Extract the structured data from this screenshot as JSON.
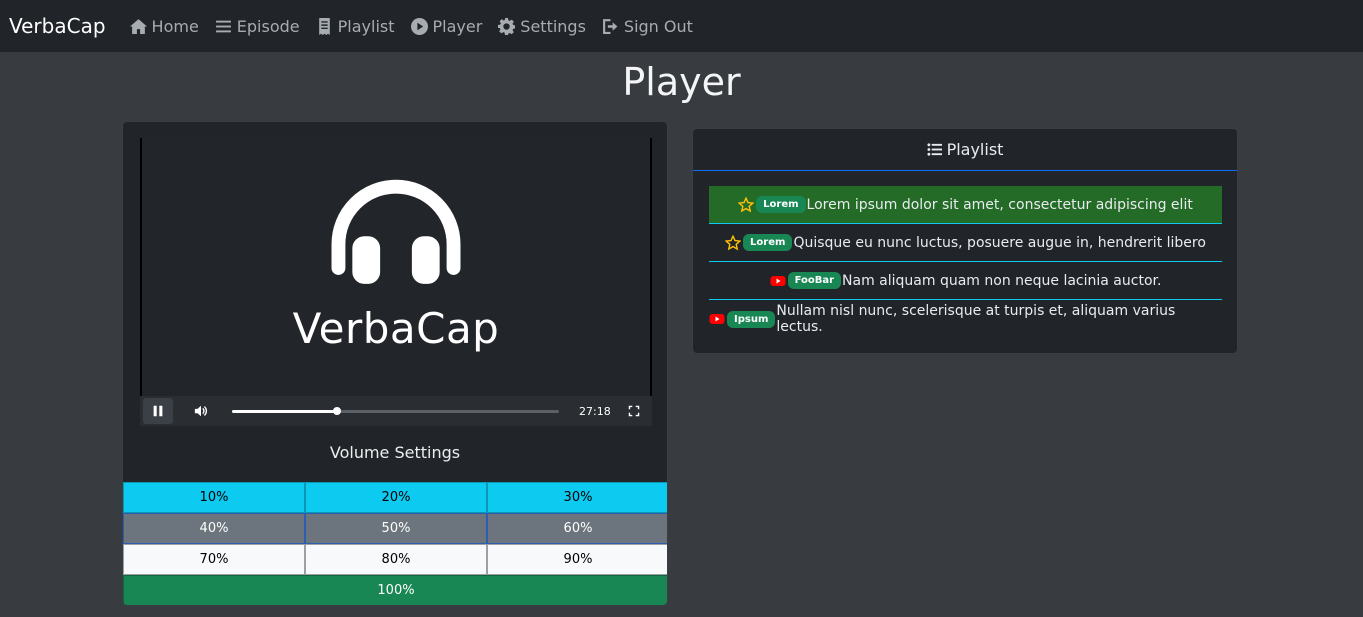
{
  "nav": {
    "brand": "VerbaCap",
    "items": [
      {
        "label": "Home",
        "icon": "home-icon"
      },
      {
        "label": "Episode",
        "icon": "list-icon"
      },
      {
        "label": "Playlist",
        "icon": "receipt-icon"
      },
      {
        "label": "Player",
        "icon": "play-circle-icon"
      },
      {
        "label": "Settings",
        "icon": "gear-icon"
      },
      {
        "label": "Sign Out",
        "icon": "sign-out-icon"
      }
    ]
  },
  "page": {
    "title": "Player"
  },
  "player": {
    "logo_text": "VerbaCap",
    "time": "27:18",
    "progress": 0.32,
    "state": "playing",
    "volume_title": "Volume Settings",
    "volume_rows": [
      [
        "10%",
        "20%",
        "30%"
      ],
      [
        "40%",
        "50%",
        "60%"
      ],
      [
        "70%",
        "80%",
        "90%"
      ],
      [
        "100%"
      ]
    ]
  },
  "playlist": {
    "title": "Playlist",
    "items": [
      {
        "icon": "star-icon",
        "badge": "Lorem",
        "text": "Lorem ipsum dolor sit amet, consectetur adipiscing elit",
        "active": true
      },
      {
        "icon": "star-icon",
        "badge": "Lorem",
        "text": "Quisque eu nunc luctus, posuere augue in, hendrerit libero",
        "active": false
      },
      {
        "icon": "youtube-icon",
        "badge": "FooBar",
        "text": "Nam aliquam quam non neque lacinia auctor.",
        "active": false
      },
      {
        "icon": "youtube-icon",
        "badge": "Ipsum",
        "text": "Nullam nisl nunc, scelerisque at turpis et, aliquam varius lectus.",
        "active": false
      }
    ]
  },
  "colors": {
    "navbar": "#212529",
    "active_item": "#236b26",
    "badge": "#198754",
    "info": "#0dcaf0",
    "star": "#ffc107",
    "youtube": "#ff0000"
  }
}
